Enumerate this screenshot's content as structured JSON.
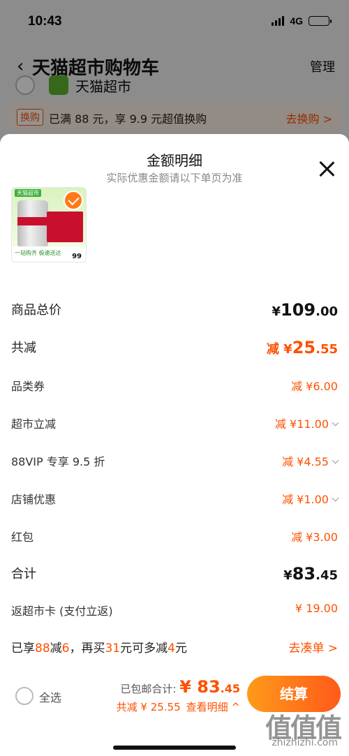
{
  "status": {
    "time": "10:43",
    "network": "4G"
  },
  "nav": {
    "title": "天猫超市购物车",
    "manage": "管理"
  },
  "store": {
    "name": "天猫超市"
  },
  "promo": {
    "tag": "换购",
    "text": "已满 88 元，享 9.9 元超值换购",
    "link": "去换购 >"
  },
  "sheet": {
    "title": "金额明细",
    "subtitle": "实际优惠金额请以下单页为准",
    "product": {
      "badge": "天猫超市",
      "tagline": "一站购齐 极速送达",
      "price": "99"
    }
  },
  "rows": {
    "subtotal": {
      "label": "商品总价",
      "prefix": "¥",
      "int": "109",
      "dec": ".00"
    },
    "total_off": {
      "label": "共减",
      "prefix": "减 ¥",
      "int": "25",
      "dec": ".55"
    },
    "category_coupon": {
      "label": "品类券",
      "value": "减 ¥6.00"
    },
    "market_off": {
      "label": "超市立减",
      "value": "减 ¥11.00"
    },
    "vip": {
      "label": "88VIP 专享 9.5 折",
      "value": "减 ¥4.55"
    },
    "store_off": {
      "label": "店铺优惠",
      "value": "减 ¥1.00"
    },
    "red_packet": {
      "label": "红包",
      "value": "减 ¥3.00"
    },
    "sum": {
      "label": "合计",
      "prefix": "¥",
      "int": "83",
      "dec": ".45"
    },
    "rebate": {
      "label": "返超市卡 (支付立返)",
      "value": "¥ 19.00"
    }
  },
  "deal": {
    "p1": "已享",
    "h1": "88",
    "p2": "减",
    "h2": "6",
    "p3": "，再买",
    "h3": "31",
    "p4": "元可多减",
    "h4": "4",
    "p5": "元",
    "link": "去凑单 >"
  },
  "bottom": {
    "select_all": "全选",
    "total_prefix": "已包邮合计: ",
    "total_int": "¥ 83",
    "total_dec": ".45",
    "save_text": "共减 ¥ 25.55",
    "detail_link": "查看明细 ^",
    "checkout": "结算"
  },
  "watermark": {
    "logo": "值值值",
    "text": "zhizhizhi.com"
  },
  "colors": {
    "accent": "#ff5000",
    "brand_green": "#3fae3f"
  }
}
